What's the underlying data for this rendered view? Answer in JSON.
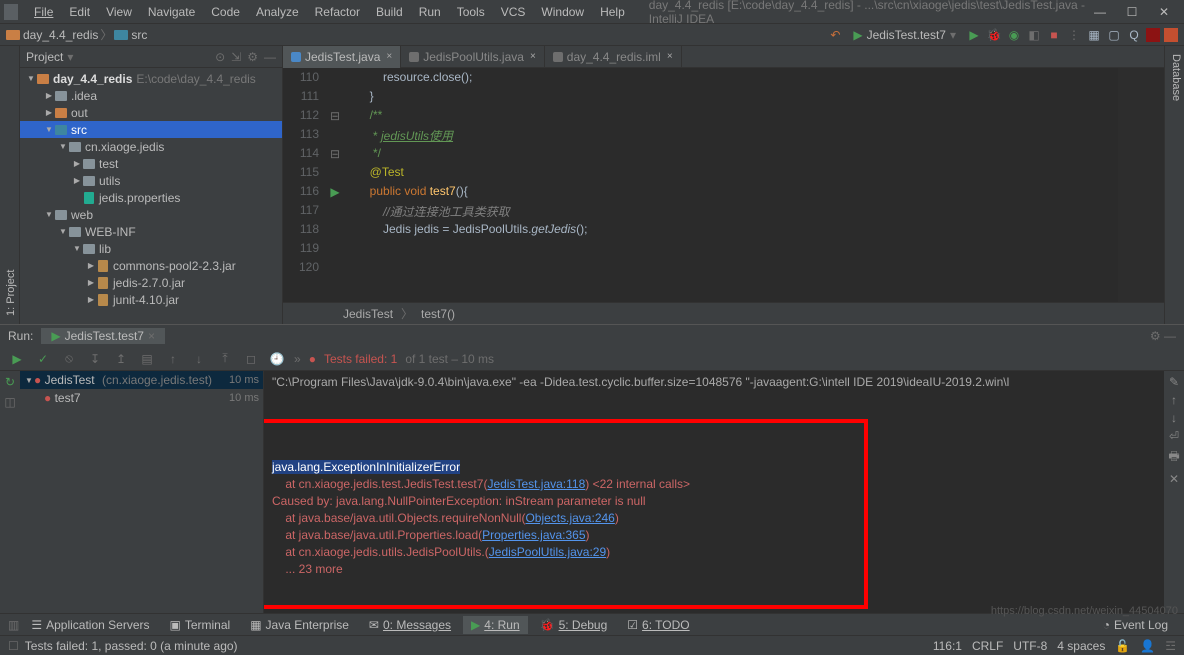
{
  "menu": {
    "file": "File",
    "edit": "Edit",
    "view": "View",
    "navigate": "Navigate",
    "code": "Code",
    "analyze": "Analyze",
    "refactor": "Refactor",
    "build": "Build",
    "run": "Run",
    "tools": "Tools",
    "vcs": "VCS",
    "window": "Window",
    "help": "Help"
  },
  "title_path": "day_4.4_redis [E:\\code\\day_4.4_redis] - ...\\src\\cn\\xiaoge\\jedis\\test\\JedisTest.java - IntelliJ IDEA",
  "breadcrumbs": {
    "root": "day_4.4_redis",
    "sep": "〉",
    "src": "src"
  },
  "runcfg": {
    "back": "←",
    "config": "JedisTest.test7"
  },
  "project": {
    "pane_title": "Project",
    "root": {
      "name": "day_4.4_redis",
      "path": "E:\\code\\day_4.4_redis"
    },
    "items": [
      {
        "pad": 24,
        "tri": "▶",
        "type": "folder",
        "name": ".idea"
      },
      {
        "pad": 24,
        "tri": "▶",
        "type": "folder-orange",
        "name": "out"
      },
      {
        "pad": 24,
        "tri": "▼",
        "type": "folder-blue",
        "name": "src",
        "sel": true
      },
      {
        "pad": 38,
        "tri": "▼",
        "type": "folder",
        "name": "cn.xiaoge.jedis"
      },
      {
        "pad": 52,
        "tri": "▶",
        "type": "folder",
        "name": "test"
      },
      {
        "pad": 52,
        "tri": "▶",
        "type": "folder",
        "name": "utils"
      },
      {
        "pad": 52,
        "tri": "",
        "type": "prop",
        "name": "jedis.properties"
      },
      {
        "pad": 24,
        "tri": "▼",
        "type": "folder",
        "name": "web"
      },
      {
        "pad": 38,
        "tri": "▼",
        "type": "folder",
        "name": "WEB-INF"
      },
      {
        "pad": 52,
        "tri": "▼",
        "type": "folder",
        "name": "lib"
      },
      {
        "pad": 66,
        "tri": "▶",
        "type": "jar",
        "name": "commons-pool2-2.3.jar"
      },
      {
        "pad": 66,
        "tri": "▶",
        "type": "jar",
        "name": "jedis-2.7.0.jar"
      },
      {
        "pad": 66,
        "tri": "▶",
        "type": "jar",
        "name": "junit-4.10.jar"
      }
    ]
  },
  "tabs": [
    {
      "name": "JedisTest.java",
      "active": true
    },
    {
      "name": "JedisPoolUtils.java",
      "active": false
    },
    {
      "name": "day_4.4_redis.iml",
      "active": false
    }
  ],
  "code": {
    "lines": [
      {
        "n": "110",
        "html": "            resource.close();"
      },
      {
        "n": "111",
        "html": "        }"
      },
      {
        "n": "112",
        "html": "        <span class='com2'>/**</span>"
      },
      {
        "n": "113",
        "html": "        <span class='com2'> * <span class='italic' style='text-decoration:underline'>jedisUtils使用</span></span>"
      },
      {
        "n": "114",
        "html": "        <span class='com2'> */</span>"
      },
      {
        "n": "115",
        "html": "        <span class='annot'>@Test</span>"
      },
      {
        "n": "116",
        "html": "        <span class='kw'>public void</span> <span class='method'>test7</span>(){",
        "mark": "▶"
      },
      {
        "n": "117",
        "html": "            <span class='com'>//通过连接池工具类获取</span>"
      },
      {
        "n": "118",
        "html": "            Jedis jedis = JedisPoolUtils.<span class='italic'>getJedis</span>();"
      },
      {
        "n": "119",
        "html": ""
      },
      {
        "n": "120",
        "html": ""
      }
    ],
    "crumb1": "JedisTest",
    "crumb2": "test7()"
  },
  "left_tools": {
    "project_label": "1: Project"
  },
  "right_tools": {
    "db": "Database"
  },
  "run": {
    "label": "Run:",
    "tab": "JedisTest.test7",
    "status": "Tests failed: 1",
    "status2": " of 1 test – 10 ms",
    "tree": {
      "root": {
        "name": "JedisTest",
        "pkg": "(cn.xiaoge.jedis.test)",
        "time": "10 ms"
      },
      "child": {
        "name": "test7",
        "time": "10 ms"
      }
    },
    "cmd": "\"C:\\Program Files\\Java\\jdk-9.0.4\\bin\\java.exe\" -ea -Didea.test.cyclic.buffer.size=1048576 \"-javaagent:G:\\intell IDE 2019\\ideaIU-2019.2.win\\l",
    "stack": [
      {
        "t0": "java.lang.ExceptionInInitializerError",
        "sel": true
      },
      {
        "t0": "    at cn.xiaoge.jedis.test.JedisTest.test7(",
        "lk": "JedisTest.java:118",
        "t1": ") <22 internal calls>"
      },
      {
        "t0": "Caused by: java.lang.NullPointerException: inStream parameter is null"
      },
      {
        "t0": "    at java.base/java.util.Objects.requireNonNull(",
        "lk": "Objects.java:246",
        "t1": ")"
      },
      {
        "t0": "    at java.base/java.util.Properties.load(",
        "lk": "Properties.java:365",
        "t1": ")"
      },
      {
        "t0": "    at cn.xiaoge.jedis.utils.JedisPoolUtils.<clinit>(",
        "lk": "JedisPoolUtils.java:29",
        "t1": ")"
      },
      {
        "t0": "    ... 23 more"
      }
    ]
  },
  "bottomtabs": {
    "appservers": "Application Servers",
    "terminal": "Terminal",
    "je": "Java Enterprise",
    "messages": "0: Messages",
    "run": "4: Run",
    "debug": "5: Debug",
    "todo": "6: TODO",
    "eventlog": "Event Log"
  },
  "statusbar": {
    "msg": "Tests failed: 1, passed: 0 (a minute ago)",
    "pos": "116:1",
    "enc": "CRLF",
    "enc2": "UTF-8",
    "indent": "4 spaces"
  },
  "watermark": "https://blog.csdn.net/weixin_44504070"
}
